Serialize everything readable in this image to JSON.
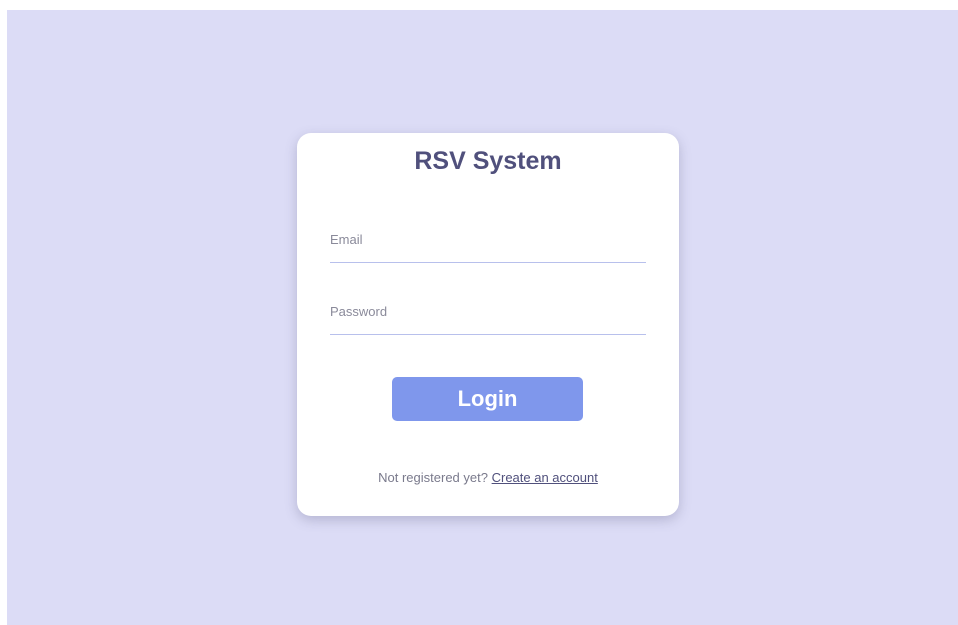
{
  "card": {
    "title": "RSV System"
  },
  "form": {
    "email_placeholder": "Email",
    "email_value": "",
    "password_placeholder": "Password",
    "password_value": "",
    "login_label": "Login"
  },
  "footer": {
    "prompt": "Not registered yet?",
    "link_label": "Create an account"
  },
  "colors": {
    "background": "#dcdcf6",
    "card": "#ffffff",
    "title": "#50507c",
    "button": "#7f97ec",
    "input_underline": "#b8c0ec"
  }
}
